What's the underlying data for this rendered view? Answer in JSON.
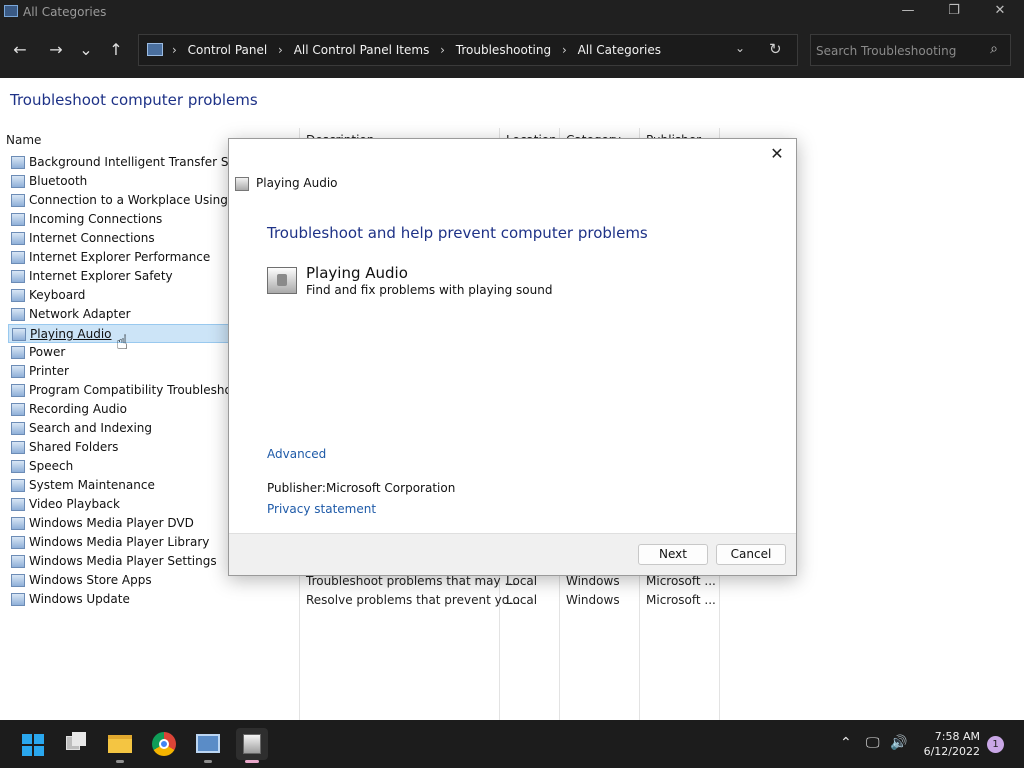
{
  "window": {
    "title": "All Categories",
    "minimize_glyph": "—",
    "restore_glyph": "❐",
    "close_glyph": "✕"
  },
  "nav": {
    "back_glyph": "←",
    "forward_glyph": "→",
    "recent_glyph": "⌄",
    "up_glyph": "↑"
  },
  "address": {
    "crumbs": [
      "Control Panel",
      "All Control Panel Items",
      "Troubleshooting",
      "All Categories"
    ],
    "separator": "›",
    "dropdown_glyph": "⌄",
    "refresh_glyph": "↻"
  },
  "search": {
    "placeholder": "Search Troubleshooting",
    "icon_glyph": "⌕"
  },
  "page": {
    "title": "Troubleshoot computer problems"
  },
  "columns": {
    "name": "Name",
    "description": "Description",
    "location": "Location",
    "category": "Category",
    "publisher": "Publisher"
  },
  "items": [
    {
      "label": "Background Intelligent Transfer Service"
    },
    {
      "label": "Bluetooth"
    },
    {
      "label": "Connection to a Workplace Using DirectAccess"
    },
    {
      "label": "Incoming Connections"
    },
    {
      "label": "Internet Connections"
    },
    {
      "label": "Internet Explorer Performance"
    },
    {
      "label": "Internet Explorer Safety"
    },
    {
      "label": "Keyboard"
    },
    {
      "label": "Network Adapter"
    },
    {
      "label": "Playing Audio"
    },
    {
      "label": "Power"
    },
    {
      "label": "Printer"
    },
    {
      "label": "Program Compatibility Troubleshooter"
    },
    {
      "label": "Recording Audio"
    },
    {
      "label": "Search and Indexing"
    },
    {
      "label": "Shared Folders"
    },
    {
      "label": "Speech"
    },
    {
      "label": "System Maintenance"
    },
    {
      "label": "Video Playback"
    },
    {
      "label": "Windows Media Player DVD"
    },
    {
      "label": "Windows Media Player Library"
    },
    {
      "label": "Windows Media Player Settings"
    },
    {
      "label": "Windows Store Apps",
      "description": "Troubleshoot problems that may ...",
      "location": "Local",
      "category": "Windows",
      "publisher": "Microsoft ..."
    },
    {
      "label": "Windows Update",
      "description": "Resolve problems that prevent yo...",
      "location": "Local",
      "category": "Windows",
      "publisher": "Microsoft ..."
    }
  ],
  "dialog": {
    "close_glyph": "✕",
    "title": "Playing Audio",
    "heading": "Troubleshoot and help prevent computer problems",
    "item_name": "Playing Audio",
    "item_description": "Find and fix problems with playing sound",
    "advanced_link": "Advanced",
    "publisher_label": "Publisher:",
    "publisher_value": "Microsoft Corporation",
    "privacy_link": "Privacy statement",
    "next_label": "Next",
    "cancel_label": "Cancel"
  },
  "taskbar": {
    "tray_chevron_glyph": "⌃",
    "network_glyph": "🖵",
    "volume_glyph": "🔊",
    "time": "7:58 AM",
    "date": "6/12/2022",
    "notification_count": "1"
  },
  "colors": {
    "accent_blue": "#1e3287",
    "link_blue": "#1e5aa8",
    "selection": "#cce4f7"
  }
}
